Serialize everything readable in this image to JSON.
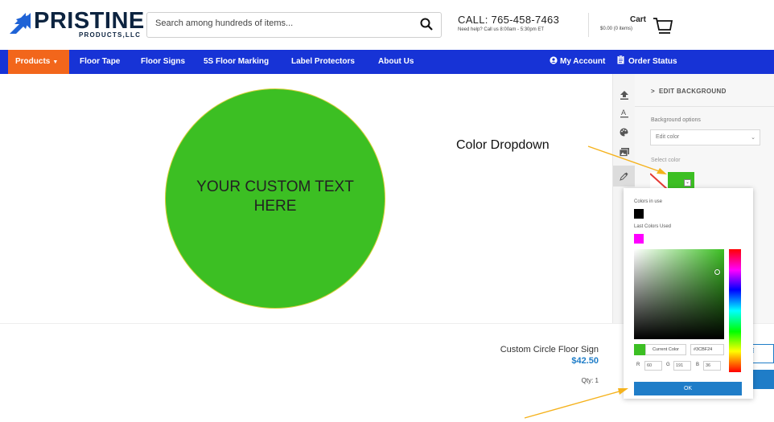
{
  "header": {
    "logo_name": "PRISTINE",
    "logo_sub": "PRODUCTS,LLC",
    "search_placeholder": "Search among hundreds of items...",
    "call_text": "CALL: 765-458-7463",
    "help_text": "Need help? Call us 8:00am - 5:30pm ET",
    "cart_title": "Cart",
    "cart_amount": "$0.00 (0 items)"
  },
  "nav": {
    "items": [
      {
        "label": "Products"
      },
      {
        "label": "Floor Tape"
      },
      {
        "label": "Floor Signs"
      },
      {
        "label": "5S Floor Marking"
      },
      {
        "label": "Label Protectors"
      },
      {
        "label": "About Us"
      }
    ],
    "account": "My Account",
    "order_status": "Order Status"
  },
  "canvas": {
    "circle_text_line1": "YOUR CUSTOM TEXT",
    "circle_text_line2": "HERE",
    "circle_color": "#3CBF23"
  },
  "panel": {
    "title": "EDIT BACKGROUND",
    "bg_options_label": "Background options",
    "bg_select_value": "Edit color",
    "select_color_label": "Select color"
  },
  "picker": {
    "colors_in_use_label": "Colors in use",
    "colors_in_use": [
      "#000000"
    ],
    "last_colors_label": "Last Colors Used",
    "last_colors": [
      "#FF00FF"
    ],
    "current_color_label": "Current Color",
    "hex_value": "#3CBF24",
    "r": "60",
    "g": "191",
    "b": "36",
    "ok_label": "OK"
  },
  "product": {
    "name": "Custom Circle Floor Sign",
    "price": "$42.50",
    "qty": "Qty: 1"
  },
  "annotations": {
    "color_dropdown": "Color Dropdown",
    "arrow_color": "#F5B21C"
  }
}
